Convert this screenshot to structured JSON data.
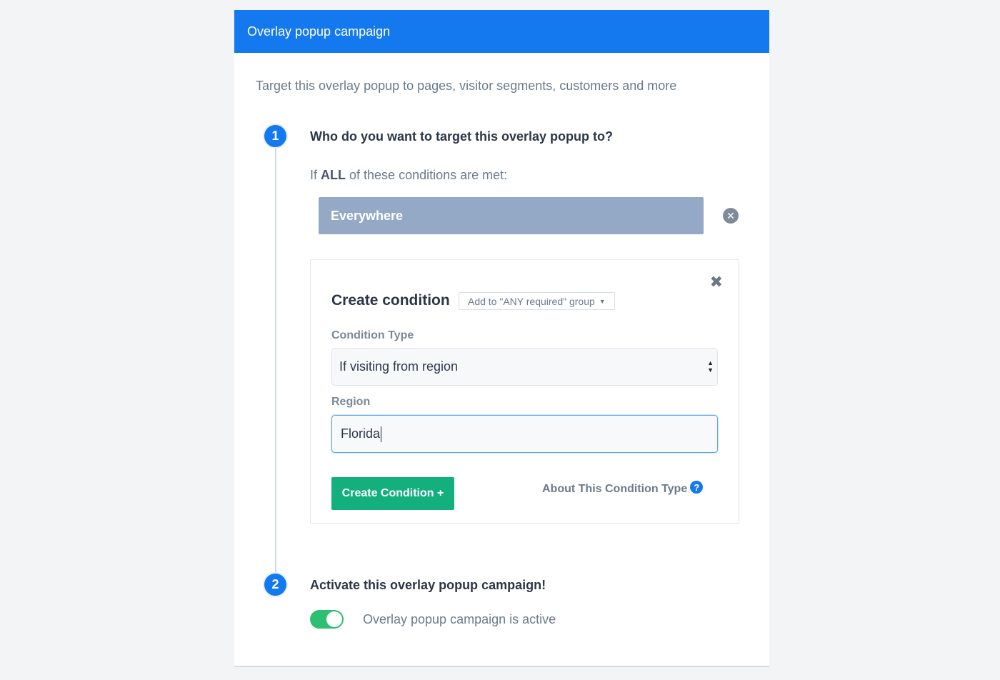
{
  "header": {
    "title": "Overlay popup campaign"
  },
  "intro": "Target this overlay popup to pages, visitor segments, customers and more",
  "steps": [
    {
      "number": "1",
      "title": "Who do you want to target this overlay popup to?"
    },
    {
      "number": "2",
      "title": "Activate this overlay popup campaign!"
    }
  ],
  "conditions": {
    "intro_prefix": "If ",
    "intro_bold": "ALL",
    "intro_suffix": " of these conditions are met:",
    "existing": "Everywhere"
  },
  "create_condition": {
    "title": "Create condition",
    "group_button": "Add to \"ANY required\" group",
    "type_label": "Condition Type",
    "type_value": "If visiting from region",
    "region_label": "Region",
    "region_value": "Florida",
    "submit_label": "Create Condition +",
    "about_label": "About This Condition Type"
  },
  "activation": {
    "toggle_on": true,
    "toggle_label": "Overlay popup campaign is active"
  },
  "colors": {
    "accent": "#1479ee",
    "success": "#13b07e",
    "toggle": "#2ebf70",
    "everywhere": "#94a9c6"
  },
  "icons": {
    "remove": "close-circle-icon",
    "close": "close-icon",
    "help": "question-circle-icon",
    "caret": "caret-down-icon"
  }
}
